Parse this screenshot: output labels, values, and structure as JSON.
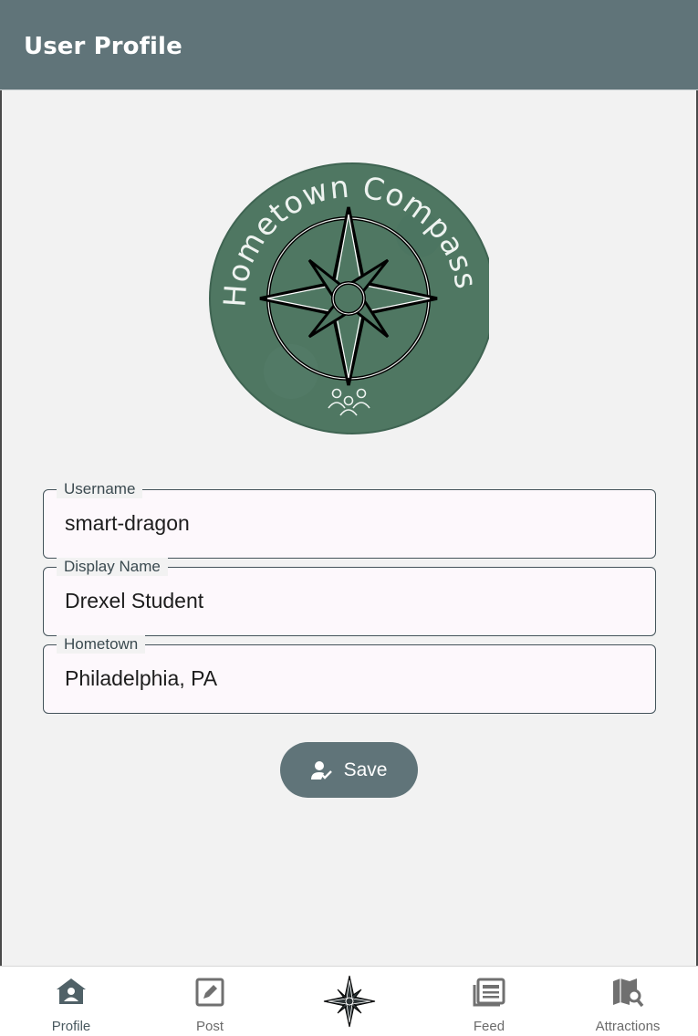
{
  "app_bar": {
    "title": "User Profile"
  },
  "logo": {
    "text": "Hometown Compass",
    "background_color": "#4f7762"
  },
  "form": {
    "username": {
      "label": "Username",
      "value": "smart-dragon"
    },
    "display_name": {
      "label": "Display Name",
      "value": "Drexel Student"
    },
    "hometown": {
      "label": "Hometown",
      "value": "Philadelphia, PA"
    }
  },
  "save_button": {
    "label": "Save",
    "icon": "person-check-icon"
  },
  "bottom_nav": {
    "items": [
      {
        "label": "Profile",
        "icon": "home-user-icon",
        "active": true
      },
      {
        "label": "Post",
        "icon": "edit-square-icon"
      },
      {
        "label": "",
        "icon": "compass-star-icon"
      },
      {
        "label": "Feed",
        "icon": "newspaper-icon"
      },
      {
        "label": "Attractions",
        "icon": "map-search-icon"
      }
    ]
  },
  "colors": {
    "primary": "#607479",
    "background": "#f2f2f2",
    "field_bg": "#fdf8fc"
  }
}
